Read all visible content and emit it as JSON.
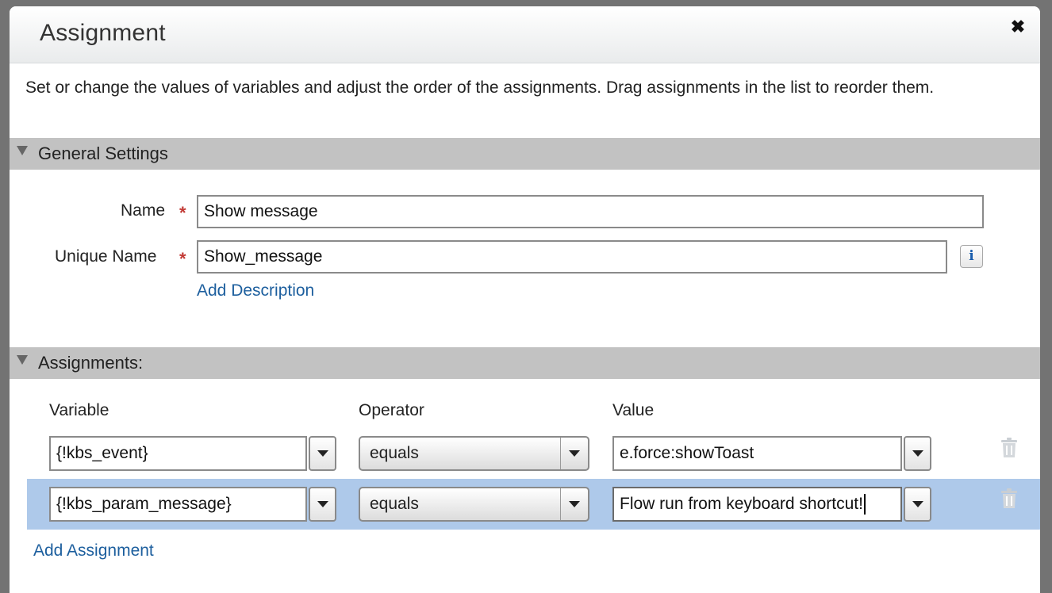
{
  "dialog": {
    "title": "Assignment",
    "close_symbol": "✖",
    "intro": "Set or change the values of variables and adjust the order of the assignments. Drag assignments in the list to reorder them."
  },
  "general_settings": {
    "header": "General Settings",
    "name_label": "Name",
    "name_value": "Show message",
    "unique_name_label": "Unique Name",
    "unique_name_value": "Show_message",
    "required_mark": "*",
    "info_symbol": "i",
    "add_description": "Add Description"
  },
  "assignments": {
    "header": "Assignments:",
    "columns": {
      "variable": "Variable",
      "operator": "Operator",
      "value": "Value"
    },
    "rows": [
      {
        "variable": "{!kbs_event}",
        "operator": "equals",
        "value": "e.force:showToast",
        "selected": false
      },
      {
        "variable": "{!kbs_param_message}",
        "operator": "equals",
        "value": "Flow run from keyboard shortcut!",
        "selected": true
      }
    ],
    "add_assignment": "Add Assignment"
  },
  "icons": [
    "close-icon",
    "collapse-triangle-icon",
    "info-icon",
    "dropdown-arrow-icon",
    "trash-icon"
  ],
  "colors": {
    "section_header_bg": "#c2c2c2",
    "selected_row_bg": "#aec9ea",
    "link": "#1d5f9e",
    "required": "#c23934"
  }
}
